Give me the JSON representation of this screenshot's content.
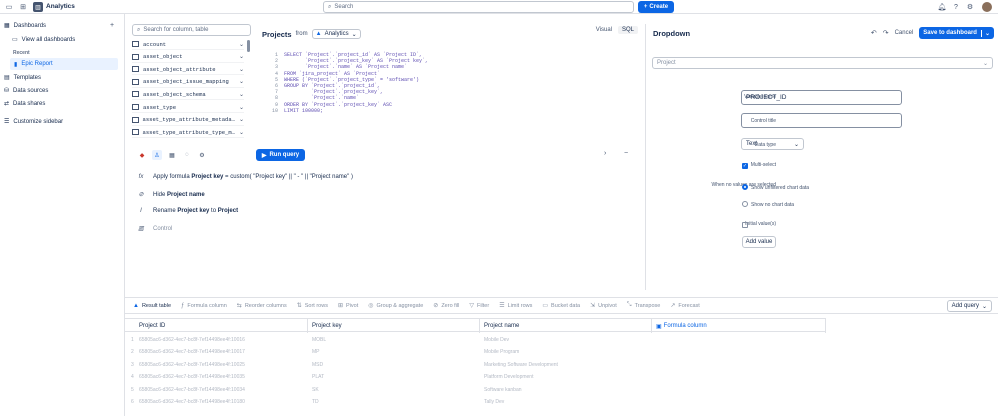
{
  "topbar": {
    "app_name": "Analytics",
    "search_placeholder": "Search",
    "create_label": "Create"
  },
  "sidebar": {
    "dashboards_label": "Dashboards",
    "view_all_label": "View all dashboards",
    "recent_label": "Recent",
    "recent_item": "Epic Report",
    "templates_label": "Templates",
    "data_sources_label": "Data sources",
    "data_shares_label": "Data shares",
    "customize_label": "Customize sidebar"
  },
  "columns": {
    "search_placeholder": "Search for column, table",
    "items": [
      "account",
      "asset_object",
      "asset_object_attribute",
      "asset_object_issue_mapping",
      "asset_object_schema",
      "asset_type",
      "asset_type_attribute_metada…",
      "asset_type_attribute_type_m…"
    ]
  },
  "editor": {
    "title": "Projects",
    "from_label": "from",
    "source": "Analytics",
    "tab_visual": "Visual",
    "tab_sql": "SQL",
    "sql_lines": [
      "SELECT `Project`.`project_id` AS `Project ID`,",
      "       `Project`.`project_key` AS `Project key`,",
      "       `Project`.`name` AS `Project name`",
      "FROM `jira_project` AS `Project`",
      "WHERE (`Project`.`project_type` = 'software')",
      "GROUP BY `Project`.`project_id`,",
      "         `Project`.`project_key`,",
      "         `Project`.`name`",
      "ORDER BY `Project`.`project_key` ASC",
      "LIMIT 100000;"
    ],
    "run_label": "Run query"
  },
  "steps": [
    {
      "pre": "Apply formula ",
      "bold": "Project key",
      "post": " = custom( \"Project key\" || \" - \" || \"Project name\" )"
    },
    {
      "pre": "Hide ",
      "bold": "Project name",
      "post": ""
    },
    {
      "pre": "Rename ",
      "bold": "Project key",
      "post": " to ",
      "bold2": "Project"
    },
    {
      "pre": "Control",
      "bold": "",
      "post": ""
    }
  ],
  "panel": {
    "title": "Dropdown",
    "cancel_label": "Cancel",
    "save_label": "Save to dashboard",
    "project_select": "Project",
    "variable_name_label": "Variable name",
    "variable_name_value": "PROJECT_ID",
    "control_title_label": "Control title",
    "control_title_value": "",
    "data_type_label": "Data type",
    "data_type_value": "Text",
    "multi_select_label": "Multi-select",
    "no_values_label": "When no values are selected",
    "opt_unfiltered": "Show unfiltered chart data",
    "opt_no_data": "Show no chart data",
    "initial_values_label": "Initial value(s)",
    "add_value_label": "Add value"
  },
  "bottom_toolbar": {
    "items": [
      "Result table",
      "Formula column",
      "Reorder columns",
      "Sort rows",
      "Pivot",
      "Group & aggregate",
      "Zero fill",
      "Filter",
      "Limit rows",
      "Bucket data",
      "Unpivot",
      "Transpose",
      "Forecast"
    ],
    "add_query_label": "Add query"
  },
  "grid": {
    "headers": [
      "Project ID",
      "Project key",
      "Project name",
      "Formula column"
    ],
    "rows": [
      [
        "1",
        "65805ac6-d362-4ec7-bc8f-7ef14498ee4f:10016",
        "MOBL",
        "Mobile Dev"
      ],
      [
        "2",
        "65805ac6-d362-4ec7-bc8f-7ef14498ee4f:10017",
        "MP",
        "Mobile Program"
      ],
      [
        "3",
        "65805ac6-d362-4ec7-bc8f-7ef14498ee4f:10025",
        "MSD",
        "Marketing Software Development"
      ],
      [
        "4",
        "65805ac6-d362-4ec7-bc8f-7ef14498ee4f:10035",
        "PLAT",
        "Platform Development"
      ],
      [
        "5",
        "65805ac6-d362-4ec7-bc8f-7ef14498ee4f:10034",
        "SK",
        "Software kanban"
      ],
      [
        "6",
        "65805ac6-d362-4ec7-bc8f-7ef14498ee4f:10180",
        "TD",
        "Tally Dev"
      ]
    ]
  }
}
